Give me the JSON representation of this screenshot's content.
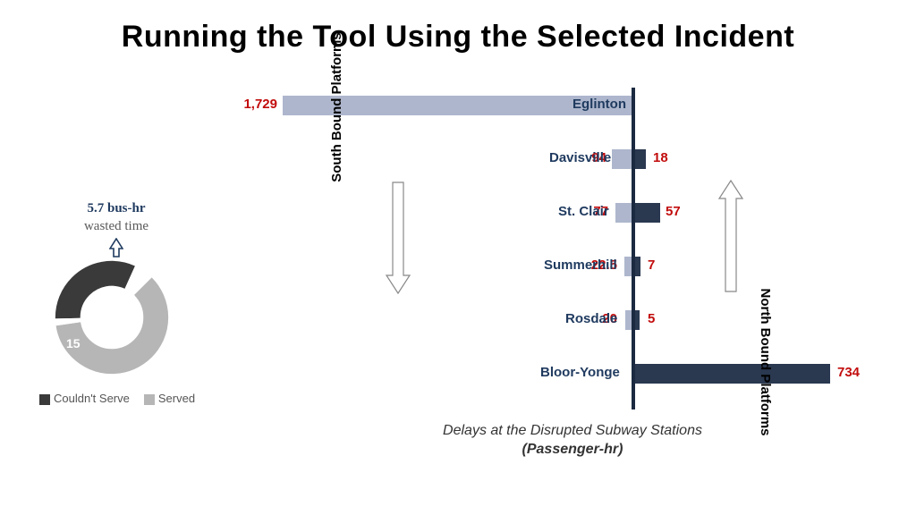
{
  "title": "Running the Tool Using the Selected Incident",
  "donut": {
    "heading_line1": "5.7 bus-hr",
    "heading_line2": "wasted time",
    "could_not_serve": 8,
    "served": 15,
    "legend_dark": "Couldn't Serve",
    "legend_light": "Served"
  },
  "barchart": {
    "south_label": "South Bound Platforms",
    "north_label": "North Bound Platforms",
    "xlabel_line1": "Delays at the Disrupted Subway Stations",
    "xlabel_line2": "(Passenger-hr)",
    "rows": {
      "eglinton": {
        "name": "Eglinton",
        "south": "1,729",
        "north": ""
      },
      "davisville": {
        "name": "Davisville",
        "south": "94",
        "north": "18"
      },
      "stclair": {
        "name": "St. Clair",
        "south": "77",
        "north": "57"
      },
      "summerhill": {
        "name": "Summerhill",
        "south": "22.5",
        "north": "7"
      },
      "rosdale": {
        "name": "Rosdale",
        "south": "20",
        "north": "5"
      },
      "blooryonge": {
        "name": "Bloor-Yonge",
        "south": "",
        "north": "734"
      }
    }
  },
  "chart_data": [
    {
      "type": "pie",
      "title": "5.7 bus-hr wasted time",
      "series": [
        {
          "name": "Couldn't Serve",
          "value": 8
        },
        {
          "name": "Served",
          "value": 15
        }
      ]
    },
    {
      "type": "bar",
      "title": "Delays at the Disrupted Subway Stations (Passenger-hr)",
      "orientation": "horizontal-diverging",
      "categories": [
        "Eglinton",
        "Davisville",
        "St. Clair",
        "Summerhill",
        "Rosdale",
        "Bloor-Yonge"
      ],
      "series": [
        {
          "name": "South Bound Platforms",
          "values": [
            1729,
            94,
            77,
            22.5,
            20,
            0
          ]
        },
        {
          "name": "North Bound Platforms",
          "values": [
            0,
            18,
            57,
            7,
            5,
            734
          ]
        }
      ],
      "xlabel": "Passenger-hr"
    }
  ],
  "colors": {
    "bar_south": "#adb6cc",
    "bar_north": "#2a3850",
    "value_red": "#c20c0c",
    "station_navy": "#1f3a5f"
  }
}
